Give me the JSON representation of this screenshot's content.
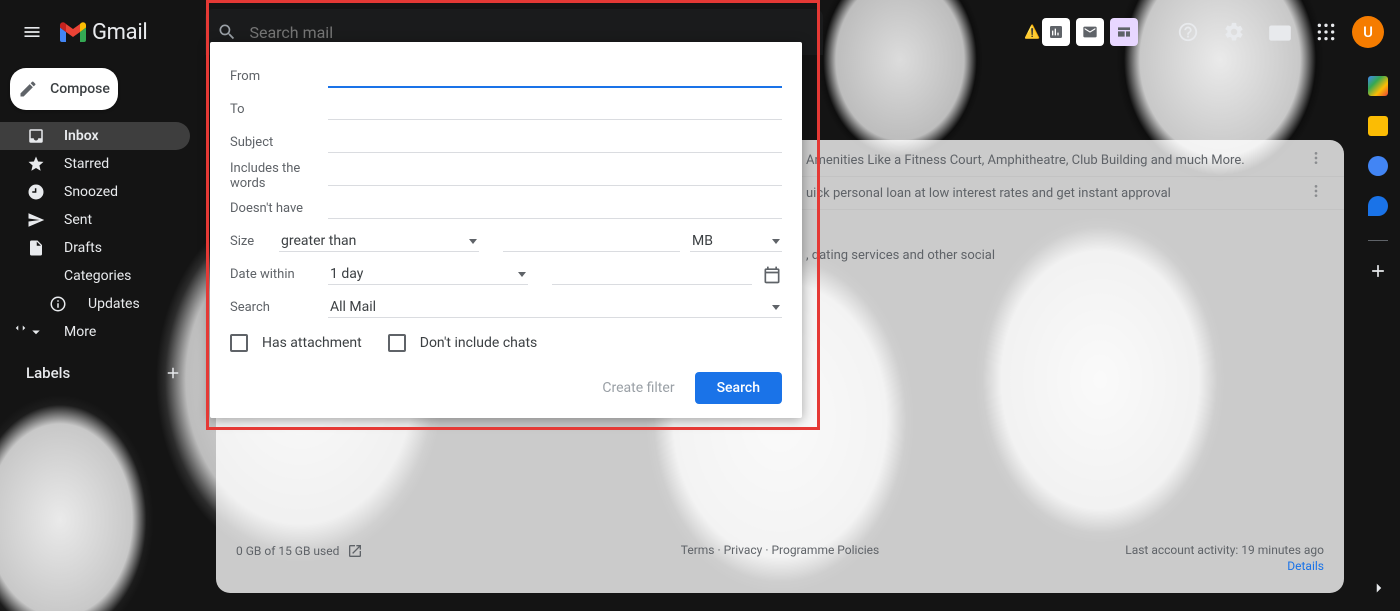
{
  "app": {
    "name": "Gmail"
  },
  "search": {
    "placeholder": "Search mail"
  },
  "compose_label": "Compose",
  "sidebar": {
    "items": [
      {
        "label": "Inbox"
      },
      {
        "label": "Starred"
      },
      {
        "label": "Snoozed"
      },
      {
        "label": "Sent"
      },
      {
        "label": "Drafts"
      },
      {
        "label": "Categories"
      },
      {
        "label": "Updates"
      },
      {
        "label": "More"
      }
    ],
    "labels_header": "Labels"
  },
  "avatar_initial": "U",
  "panel": {
    "from": "From",
    "to": "To",
    "subject": "Subject",
    "includes": "Includes the words",
    "doesnt": "Doesn't have",
    "size": "Size",
    "size_op": "greater than",
    "size_unit": "MB",
    "date": "Date within",
    "date_val": "1 day",
    "search_label": "Search",
    "search_val": "All Mail",
    "has_attachment": "Has attachment",
    "no_chats": "Don't include chats",
    "create_filter": "Create filter",
    "search_btn": "Search"
  },
  "mails": [
    {
      "snippet": "Amenities Like a Fitness Court, Amphitheatre, Club Building and much More."
    },
    {
      "snippet": "uick personal loan at low interest rates and get instant approval"
    }
  ],
  "category_snippet": ", dating services and other social",
  "footer": {
    "storage": "0 GB of 15 GB used",
    "terms": "Terms",
    "privacy": "Privacy",
    "policies": "Programme Policies",
    "activity": "Last account activity: 19 minutes ago",
    "details": "Details"
  }
}
